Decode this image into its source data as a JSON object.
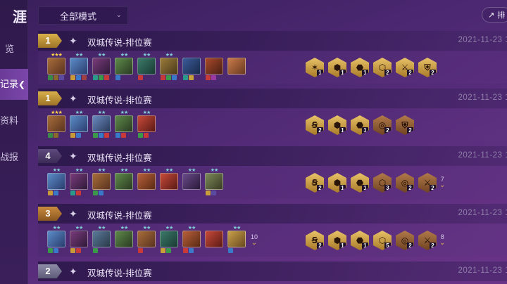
{
  "sidebar": {
    "title": "涯",
    "items": [
      {
        "label": "览",
        "active": false
      },
      {
        "label": "记录",
        "active": true
      },
      {
        "label": "资料",
        "active": false
      },
      {
        "label": "战报",
        "active": false
      }
    ]
  },
  "filter": {
    "mode_label": "全部模式"
  },
  "rank_button": {
    "label": "排"
  },
  "matches": [
    {
      "placement": "1",
      "mode": "双城传说-排位赛",
      "date": "2021-11-23 1",
      "more_units": "",
      "more_traits": ""
    },
    {
      "placement": "1",
      "mode": "双城传说-排位赛",
      "date": "2021-11-23 1",
      "more_units": "",
      "more_traits": ""
    },
    {
      "placement": "4",
      "mode": "双城传说-排位赛",
      "date": "2021-11-23 1",
      "more_units": "",
      "more_traits": "7"
    },
    {
      "placement": "3",
      "mode": "双城传说-排位赛",
      "date": "2021-11-23 1",
      "more_units": "10",
      "more_traits": "8"
    },
    {
      "placement": "2",
      "mode": "双城传说-排位赛",
      "date": "2021-11-23 1",
      "more_units": "",
      "more_traits": ""
    }
  ],
  "trait_counts": {
    "m0": [
      "1",
      "1",
      "1",
      "2",
      "2",
      "2"
    ],
    "m1": [
      "2",
      "1",
      "1",
      "2",
      "2"
    ],
    "m2": [
      "2",
      "1",
      "1",
      "3",
      "2",
      "2"
    ],
    "m3": [
      "2",
      "1",
      "1",
      "5",
      "2",
      "2"
    ]
  }
}
